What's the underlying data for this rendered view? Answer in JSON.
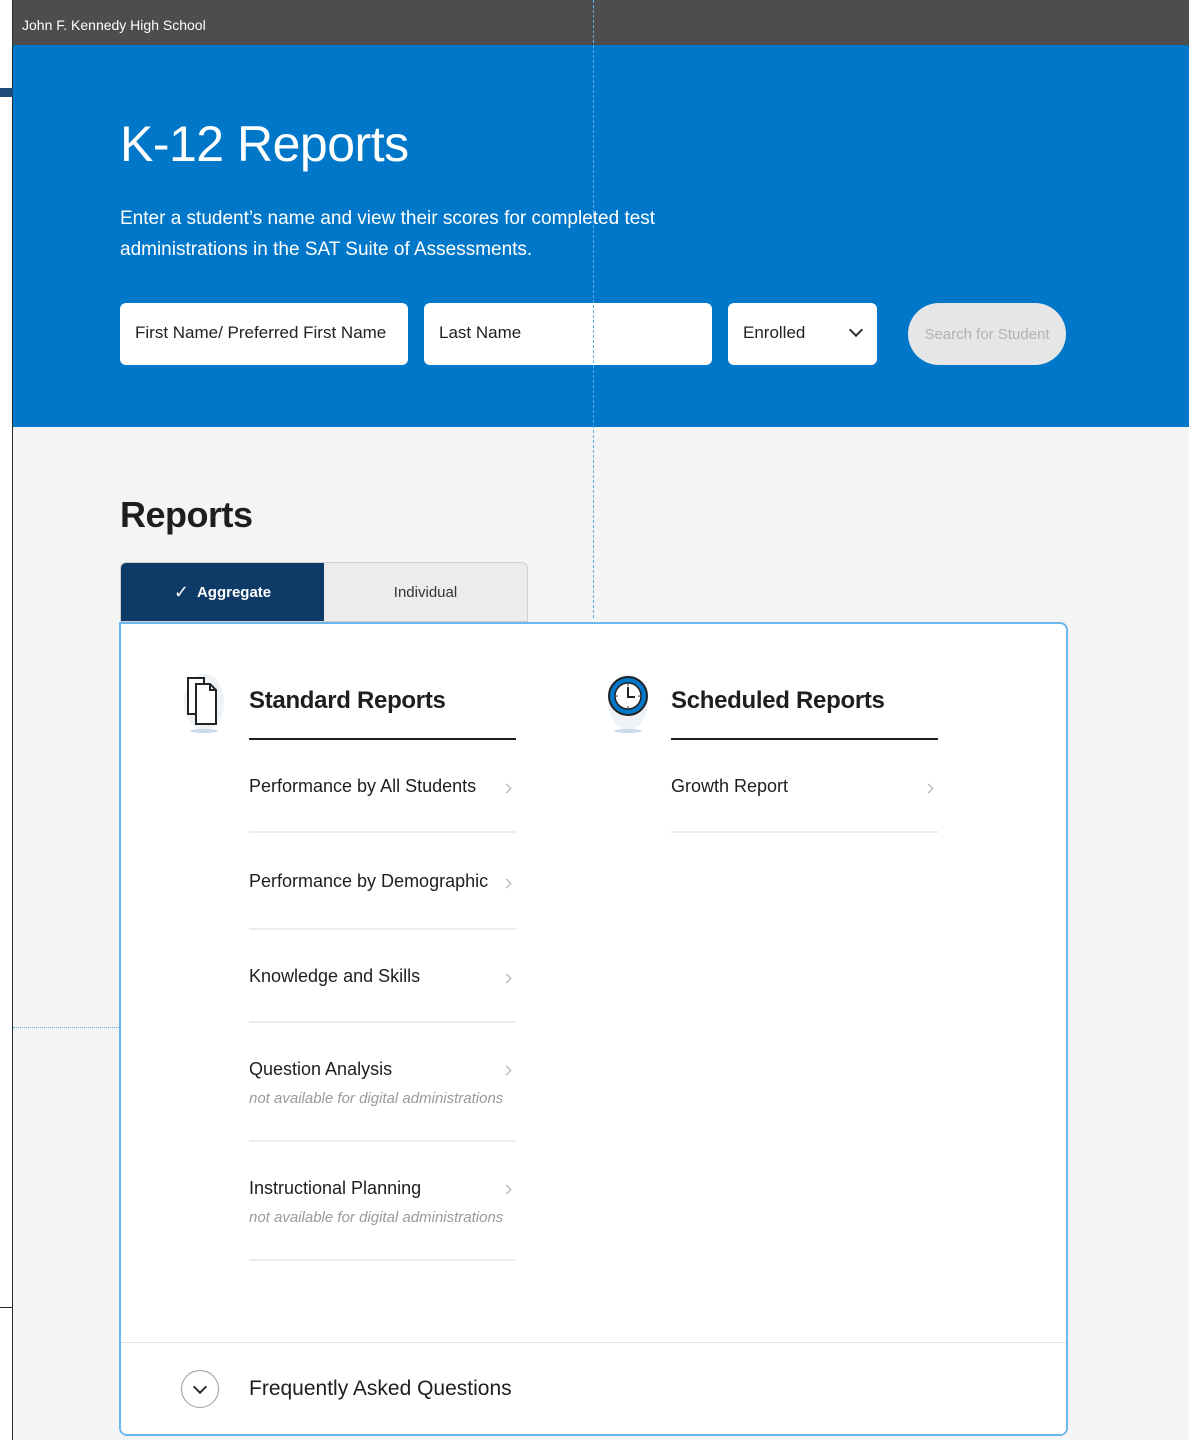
{
  "topbar": {
    "school_name": "John F. Kennedy High School"
  },
  "hero": {
    "title": "K-12 Reports",
    "description": "Enter a student’s name and view their scores for completed test administrations in the SAT Suite of Assessments.",
    "first_name_placeholder": "First Name/ Preferred First Name",
    "last_name_placeholder": "Last Name",
    "status_selected": "Enrolled",
    "search_button": "Search for Student"
  },
  "reports": {
    "title": "Reports",
    "tabs": [
      {
        "label": "Aggregate",
        "active": true
      },
      {
        "label": "Individual",
        "active": false
      }
    ],
    "standard": {
      "heading": "Standard Reports",
      "icon": "documents-icon",
      "items": [
        {
          "label": "Performance by All Students"
        },
        {
          "label": "Performance by Demographic"
        },
        {
          "label": "Knowledge and Skills"
        },
        {
          "label": "Question Analysis",
          "note": "not available for digital administrations"
        },
        {
          "label": "Instructional Planning",
          "note": "not available for digital administrations"
        }
      ]
    },
    "scheduled": {
      "heading": "Scheduled Reports",
      "icon": "clock-icon",
      "items": [
        {
          "label": "Growth Report"
        }
      ]
    },
    "faq_label": "Frequently Asked Questions"
  },
  "colors": {
    "hero_blue": "#0077c8",
    "topbar_gray": "#4d4d4d",
    "active_tab_navy": "#0d3a66",
    "card_border": "#6cb6ee"
  }
}
